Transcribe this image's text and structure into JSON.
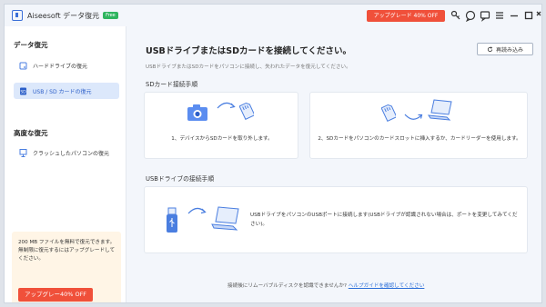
{
  "app": {
    "title": "Aiseesoft データ復元",
    "badge": "Free",
    "upgrade_label": "アップグレード 40% OFF"
  },
  "toolbar": {
    "icons": [
      "key-icon",
      "chat-icon",
      "message-icon",
      "menu-icon",
      "minimize-icon",
      "maximize-icon",
      "close-icon"
    ]
  },
  "sidebar": {
    "data_recovery_heading": "データ復元",
    "items": [
      {
        "label": "ハードドライブの復元",
        "icon": "hard-drive-icon",
        "active": false
      },
      {
        "label": "USB / SD カードの復元",
        "icon": "usb-sd-icon",
        "active": true
      }
    ],
    "advanced_heading": "高度な復元",
    "advanced_items": [
      {
        "label": "クラッシュしたパソコンの復元",
        "icon": "computer-icon",
        "active": false
      }
    ],
    "promo": {
      "text": "200 MB ファイルを無料で復元できます。無制限に復元するにはアップグレードしてください。",
      "button_label": "アップグレー40% OFF"
    }
  },
  "main": {
    "title": "USBドライブまたはSDカードを接続してください。",
    "reload_label": "再読み込み",
    "subtitle": "USBドライブまたはSDカードをパソコンに接続し、失われたデータを復元してください。",
    "sd_section_label": "SDカード接続手順",
    "sd_steps": [
      "1、デバイスからSDカードを取り外します。",
      "2、SDカードをパソコンのカードスロットに挿入するか、カードリーダーを使用します。"
    ],
    "usb_section_label": "USBドライブの接続手順",
    "usb_step": "USBドライブをパソコンのUSBポートに接続します(USBドライブが認識されない場合は、ポートを変更してみてください)。",
    "footer_text": "接続後にリムーバブルディスクを認識できませんか?",
    "footer_link": "ヘルプガイドを確認してください"
  },
  "colors": {
    "accent": "#2c5fc9",
    "upgrade": "#f0503a",
    "free_badge": "#2fb55f",
    "link": "#2c6fd8"
  }
}
